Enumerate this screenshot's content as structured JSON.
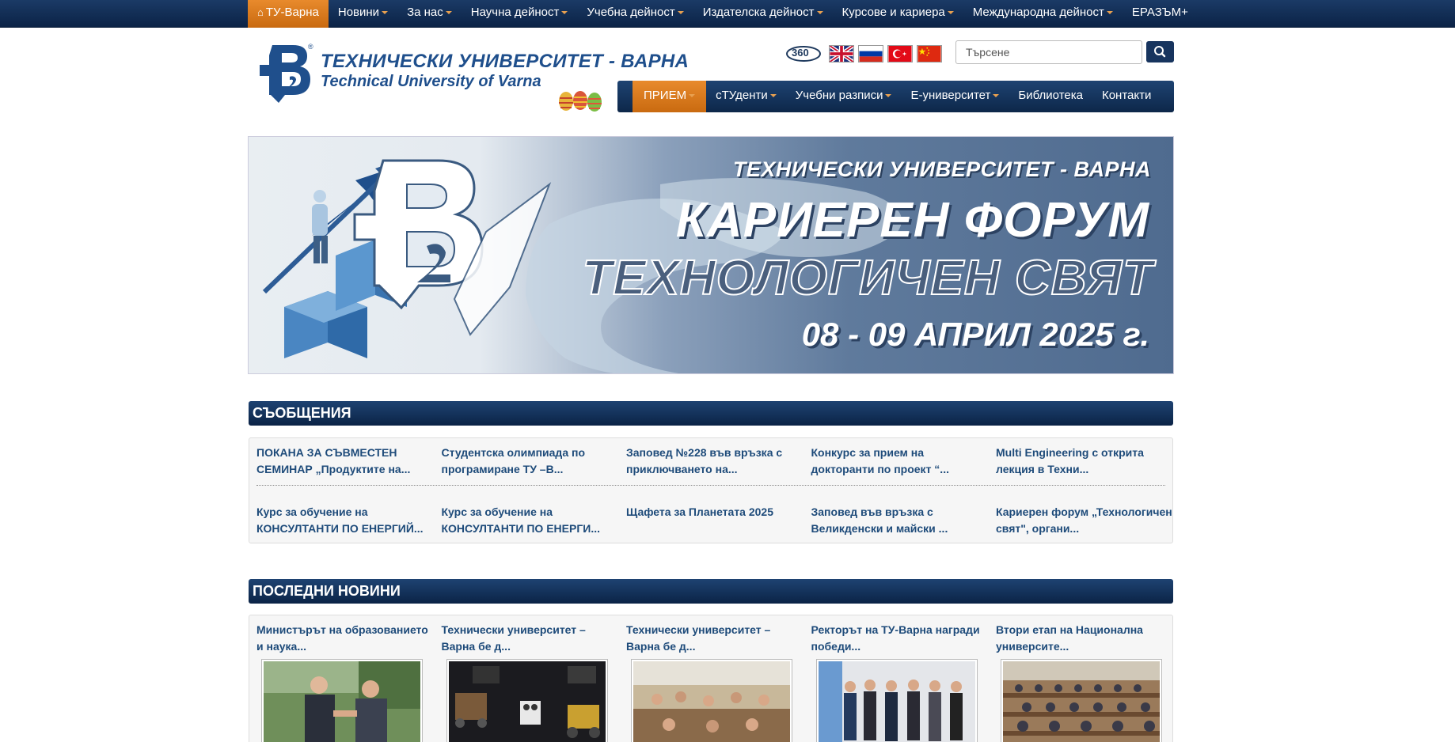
{
  "topnav": [
    {
      "label": "ТУ-Варна",
      "active": true,
      "dropdown": false,
      "icon": "home-icon"
    },
    {
      "label": "Новини",
      "dropdown": true
    },
    {
      "label": "За нас",
      "dropdown": true
    },
    {
      "label": "Научна дейност",
      "dropdown": true
    },
    {
      "label": "Учебна дейност",
      "dropdown": true
    },
    {
      "label": "Издателска дейност",
      "dropdown": true
    },
    {
      "label": "Курсове и кариера",
      "dropdown": true
    },
    {
      "label": "Международна дейност",
      "dropdown": true
    },
    {
      "label": "ЕРАЗЪМ+",
      "dropdown": false
    }
  ],
  "header": {
    "title_bg": "ТЕХНИЧЕСКИ УНИВЕРСИТЕТ - ВАРНА",
    "title_en": "Technical University of Varna",
    "logo_text": "В2",
    "icon360": "360"
  },
  "flags": [
    "uk-flag",
    "russia-flag",
    "turkey-flag",
    "china-flag"
  ],
  "search": {
    "placeholder": "Търсене",
    "icon": "search-icon"
  },
  "mainnav": [
    {
      "label": "ПРИЕМ",
      "active": true,
      "dropdown": true
    },
    {
      "label": "сТУденти",
      "dropdown": true
    },
    {
      "label": "Учебни разписи",
      "dropdown": true
    },
    {
      "label": "Е-университет",
      "dropdown": true
    },
    {
      "label": "Библиотека",
      "dropdown": false
    },
    {
      "label": "Контакти",
      "dropdown": false
    }
  ],
  "banner": {
    "title": "ТЕХНИЧЕСКИ УНИВЕРСИТЕТ - ВАРНА",
    "line1": "КАРИЕРЕН ФОРУМ",
    "line2": "ТЕХНОЛОГИЧЕН СВЯТ",
    "date": "08 - 09 АПРИЛ 2025 г."
  },
  "announcements": {
    "heading": "СЪОБЩЕНИЯ",
    "row1": [
      "ПОКАНА ЗА СЪВМЕСТЕН СЕМИНАР „Продуктите на...",
      "Студентска олимпиада по програмиране ТУ –В...",
      "Заповед №228 във връзка с приключването на...",
      "Конкурс за прием на докторанти по проект “...",
      "Multi Engineering с открита лекция в Техни..."
    ],
    "row2": [
      "Курс за обучение на КОНСУЛТАНТИ ПО ЕНЕРГИЙ...",
      "Курс за обучение на КОНСУЛТАНТИ ПО ЕНЕРГИ...",
      "Щафета за Планетата 2025",
      "Заповед във връзка с Великденски и майски ...",
      "Кариерен форум „Технологичен свят\", органи..."
    ]
  },
  "news": {
    "heading": "ПОСЛЕДНИ НОВИНИ",
    "items": [
      "Министърът на образованието и наука...",
      "Технически университет – Варна бе д...",
      "Технически университет – Варна бе д...",
      "Ректорът на ТУ-Варна награди победи...",
      "Втори етап на Национална университе..."
    ]
  },
  "colors": {
    "navy": "#0b2346",
    "orange": "#e07a1c",
    "link": "#1e4b7a"
  }
}
